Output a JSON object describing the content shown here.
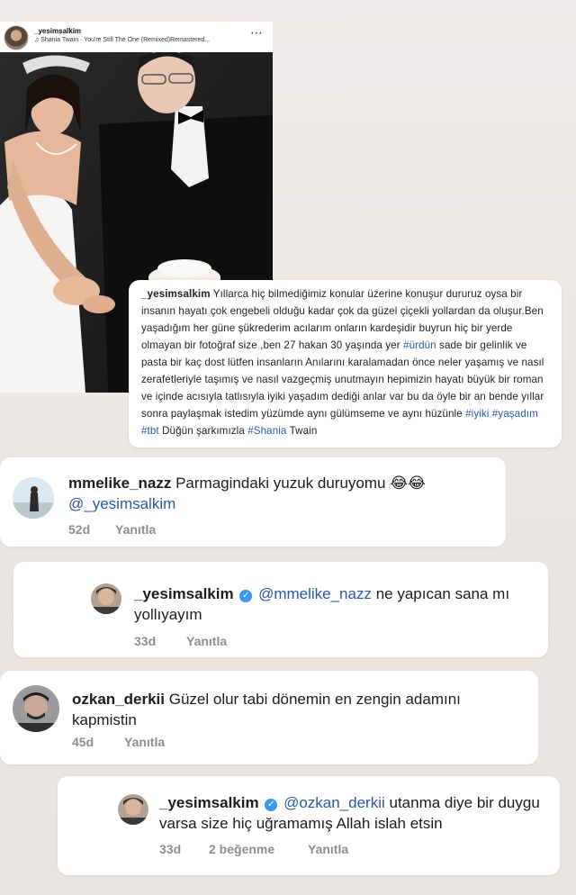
{
  "post": {
    "username": "_yesimsalkim",
    "music": "Shania Twain · You're Still The One (Remixed)Remastered...",
    "more_icon": "⋯"
  },
  "caption": {
    "username": "_yesimsalkim",
    "text_1": "Yıllarca hiç bilmediğimiz konular üzerine konuşur dururuz oysa bir insanın hayatı çok engebeli olduğu kadar çok da güzel çiçekli yollardan da oluşur.Ben yaşadığım her güne şükrederim acılarım onların kardeşidir buyrun hiç bir yerde olmayan bir fotoğraf size ,ben 27 hakan 30 yaşında yer",
    "tag_urdun": "#ürdün",
    "text_2": "sade bir gelinlik ve pasta bir kaç dost lütfen insanların Anılarını karalamadan önce neler yaşamış ve nasıl zerafetleriyle taşımış ve nasıl vazgeçmiş unutmayın hepimizin hayatı büyük bir roman ve içinde acısıyla tatlısıyla iyiki yaşadım dediği anlar var bu da öyle bir an bende yıllar sonra paylaşmak istedim yüzümde aynı gülümseme ve aynı hüzünle",
    "tag_iyiki": "#iyiki",
    "tag_yasadim": "#yaşadım",
    "tag_tbt": "#tbt",
    "text_3": "Düğün şarkımızla",
    "tag_shania": "#Shania",
    "text_4": "Twain"
  },
  "comments": [
    {
      "username": "mmelike_nazz",
      "text": "Parmagindaki yuzuk duruyomu 😂😂",
      "mention": "@_yesimsalkim",
      "time": "52d",
      "reply_label": "Yanıtla"
    },
    {
      "username": "_yesimsalkim",
      "mention": "@mmelike_nazz",
      "text": "ne yapıcan sana mı yollıyayım",
      "time": "33d",
      "reply_label": "Yanıtla"
    },
    {
      "username": "ozkan_derkii",
      "text": "Güzel olur tabi dönemin en zengin adamını kapmistin",
      "time": "45d",
      "reply_label": "Yanıtla"
    },
    {
      "username": "_yesimsalkim",
      "mention": "@ozkan_derkii",
      "text": "utanma diye bir duygu varsa size hiç uğramamış Allah islah etsin",
      "time": "33d",
      "likes": "2 beğenme",
      "reply_label": "Yanıtla"
    }
  ],
  "colors": {
    "background": "#ece6e4",
    "mention": "#2a59a8",
    "meta": "#8e8e8e",
    "verified": "#3897f0"
  }
}
